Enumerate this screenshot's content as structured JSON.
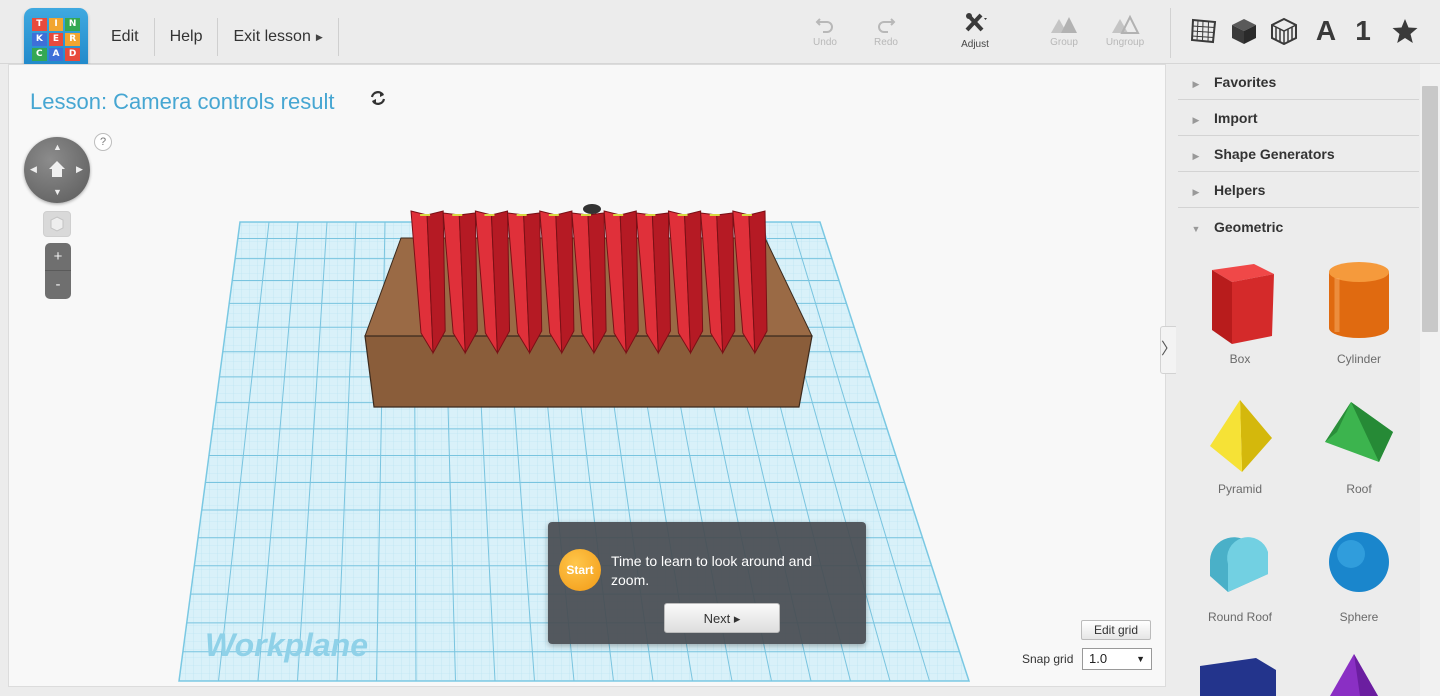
{
  "app": {
    "logo_letters": [
      "TIN",
      "KER",
      "CAD"
    ]
  },
  "menu": {
    "items": [
      {
        "label": "Edit"
      },
      {
        "label": "Help"
      },
      {
        "label": "Exit lesson"
      }
    ]
  },
  "toolbar": {
    "undo": "Undo",
    "redo": "Redo",
    "adjust": "Adjust",
    "group": "Group",
    "ungroup": "Ungroup"
  },
  "view_icons": [
    "grid-icon",
    "box-icon",
    "lattice-icon",
    "text-icon",
    "number-icon",
    "star-icon"
  ],
  "view_text": {
    "letter": "A",
    "number": "1"
  },
  "lesson": {
    "title": "Lesson: Camera controls result"
  },
  "viewport": {
    "help": "?",
    "workplane_label": "Workplane",
    "zoom_in": "+",
    "zoom_out": "-"
  },
  "tip": {
    "badge": "Start",
    "text": "Time to learn to look around and zoom.",
    "next": "Next ▸"
  },
  "grid": {
    "edit_label": "Edit grid",
    "snap_label": "Snap grid",
    "snap_value": "1.0"
  },
  "panel": {
    "sections": [
      "Favorites",
      "Import",
      "Shape Generators",
      "Helpers",
      "Geometric"
    ],
    "shapes": [
      {
        "name": "Box",
        "color": "#d42a2a"
      },
      {
        "name": "Cylinder",
        "color": "#ef7a18"
      },
      {
        "name": "Pyramid",
        "color": "#f0d81e"
      },
      {
        "name": "Roof",
        "color": "#36a84a"
      },
      {
        "name": "Round Roof",
        "color": "#5ec4d8"
      },
      {
        "name": "Sphere",
        "color": "#1e8ed0"
      }
    ]
  },
  "colors": {
    "accent": "#46a6d2",
    "grid_blue": "#8fd1e8",
    "base_brown": "#9a6a45",
    "fold_red": "#c8202a"
  }
}
